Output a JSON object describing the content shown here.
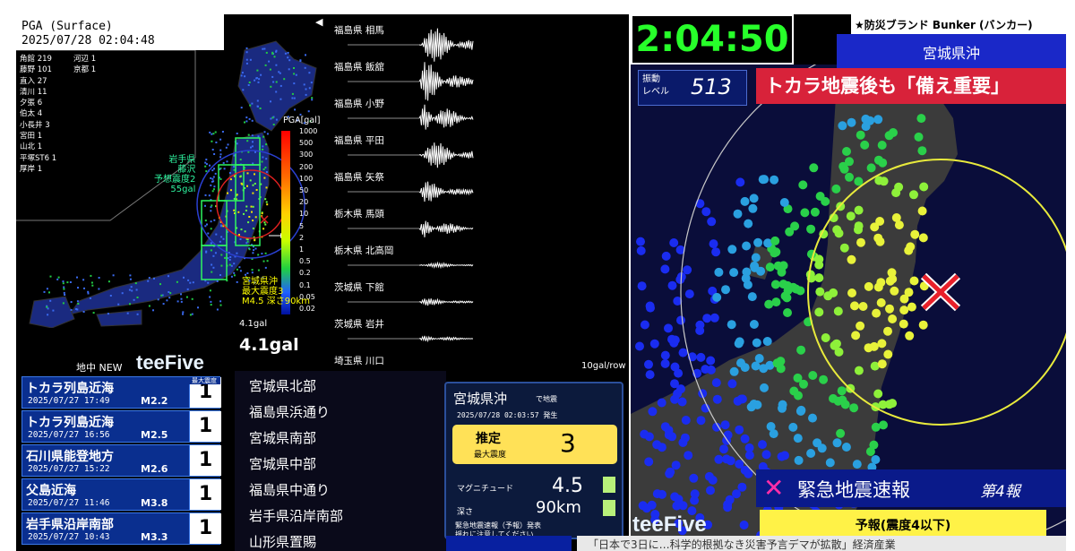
{
  "pga": {
    "title": "PGA (Surface)",
    "datetime": "2025/07/28 02:04:48"
  },
  "stations": [
    "角館 219",
    "河辺 1",
    "藤野 101",
    "京都 1",
    "直入 27",
    "",
    "清川 11",
    "",
    "夕張 6",
    "",
    "伯太 4",
    "",
    "小長井 3",
    "",
    "宮田 1",
    "",
    "山北 1",
    "",
    "平塚ST6 1",
    "",
    "厚岸 1",
    ""
  ],
  "waves": [
    "福島県 相馬",
    "福島県 飯舘",
    "福島県 小野",
    "福島県 平田",
    "福島県 矢祭",
    "栃木県 馬頭",
    "栃木県 北高岡",
    "茨城県 下館",
    "茨城県 岩井",
    "埼玉県 川口"
  ],
  "wave_arrow": "◀",
  "pga_scale": {
    "title": "PGA[gal]",
    "labels": [
      "1000",
      "500",
      "300",
      "200",
      "100",
      "50",
      "20",
      "10",
      "5",
      "2",
      "1",
      "0.5",
      "0.2",
      "0.1",
      "0.05",
      "0.02"
    ]
  },
  "iwate_info": {
    "line1": "岩手県",
    "line2": "藤沢",
    "line3": "予想震度2",
    "line4": "55gal"
  },
  "miyagi_info": {
    "line1": "宮城県沖",
    "line2": "最大震度3",
    "line3": "M4.5 深さ90km"
  },
  "gal_small": "4.1gal",
  "gal_big": "4.1gal",
  "chichu": "地中 NEW",
  "brand": "teeFive",
  "scale_right": "10gal/row",
  "quake_list": {
    "header": "最大震度",
    "items": [
      {
        "name": "トカラ列島近海",
        "time": "2025/07/27 17:49",
        "mag": "M2.2",
        "intensity": "1"
      },
      {
        "name": "トカラ列島近海",
        "time": "2025/07/27 16:56",
        "mag": "M2.5",
        "intensity": "1"
      },
      {
        "name": "石川県能登地方",
        "time": "2025/07/27 15:22",
        "mag": "M2.6",
        "intensity": "1"
      },
      {
        "name": "父島近海",
        "time": "2025/07/27 11:46",
        "mag": "M3.8",
        "intensity": "1"
      },
      {
        "name": "岩手県沿岸南部",
        "time": "2025/07/27 10:43",
        "mag": "M3.3",
        "intensity": "1"
      }
    ]
  },
  "regions": [
    "宮城県北部",
    "福島県浜通り",
    "宮城県南部",
    "宮城県中部",
    "福島県中通り",
    "岩手県沿岸南部",
    "山形県置賜"
  ],
  "card": {
    "title": "宮城県沖",
    "title_sub": "で地震",
    "time": "2025/07/28 02:03:57 発生",
    "estimate_label": "推定",
    "max_label": "最大震度",
    "max_value": "3",
    "mag_label": "マグニチュード",
    "mag_value": "4.5",
    "depth_label": "深さ",
    "depth_value": "90km",
    "note_line1": "緊急地震速報（予報）発表",
    "note_line2": "揺れに注意してください"
  },
  "right": {
    "clock": "2:04:50",
    "bunker": "★防災ブランド Bunker (バンカー)",
    "pref": "宮城県沖",
    "shindo_label_1": "振動",
    "shindo_label_2": "レベル",
    "shindo_value": "513",
    "headline": "トカラ地震後も「備え重要」",
    "eew_icon": "✕",
    "eew_title": "緊急地震速報",
    "eew_report": "第4報",
    "forecast": "予報(震度4以下)",
    "bottom_text": "「日本で3日に…科学的根拠なき災害予言デマが拡散」経済産業"
  },
  "colors": {
    "clock": "#27ff2a",
    "headline_bg": "#d8223a",
    "forecast_bg": "#fff247",
    "eew_icon": "#ff2ea8"
  }
}
